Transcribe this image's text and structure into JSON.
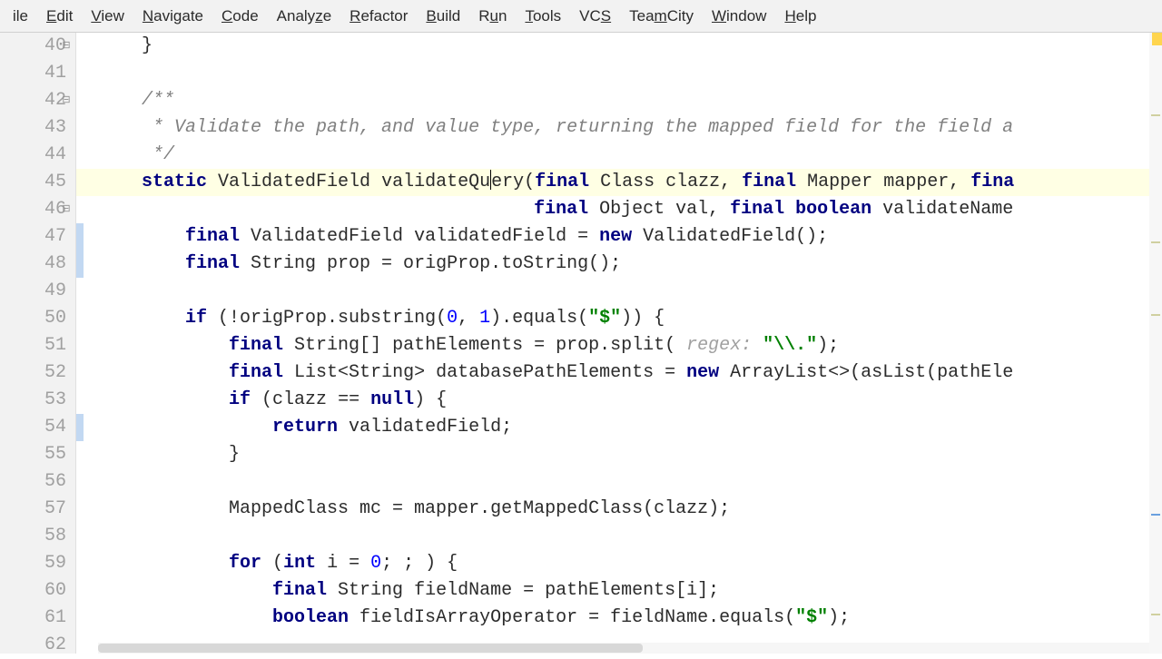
{
  "menu": {
    "file": "ile",
    "edit": "Edit",
    "view": "View",
    "navigate": "Navigate",
    "code": "Code",
    "analyze": "Analyze",
    "refactor": "Refactor",
    "build": "Build",
    "run": "Run",
    "tools": "Tools",
    "vcs": "VCS",
    "teamcity": "TeamCity",
    "window": "Window",
    "help": "Help"
  },
  "gutter": {
    "start": 40,
    "end": 62
  },
  "code": {
    "lines": [
      {
        "n": 40,
        "indent": "    ",
        "tokens": [
          {
            "t": "}",
            "c": ""
          }
        ]
      },
      {
        "n": 41,
        "indent": "",
        "tokens": []
      },
      {
        "n": 42,
        "indent": "    ",
        "tokens": [
          {
            "t": "/**",
            "c": "comment"
          }
        ]
      },
      {
        "n": 43,
        "indent": "     ",
        "tokens": [
          {
            "t": "* Validate the path, and value type, returning the mapped field for the field a",
            "c": "comment"
          }
        ]
      },
      {
        "n": 44,
        "indent": "     ",
        "tokens": [
          {
            "t": "*/",
            "c": "comment"
          }
        ]
      },
      {
        "n": 45,
        "indent": "    ",
        "current": true,
        "tokens": [
          {
            "t": "static",
            "c": "kw"
          },
          {
            "t": " ValidatedField validateQu",
            "c": ""
          },
          {
            "t": "|CARET|",
            "c": ""
          },
          {
            "t": "ery(",
            "c": ""
          },
          {
            "t": "final",
            "c": "kw"
          },
          {
            "t": " Class clazz, ",
            "c": ""
          },
          {
            "t": "final",
            "c": "kw"
          },
          {
            "t": " Mapper mapper, ",
            "c": ""
          },
          {
            "t": "fina",
            "c": "kw"
          }
        ]
      },
      {
        "n": 46,
        "indent": "                                        ",
        "tokens": [
          {
            "t": "final",
            "c": "kw"
          },
          {
            "t": " Object val, ",
            "c": ""
          },
          {
            "t": "final",
            "c": "kw"
          },
          {
            "t": " ",
            "c": ""
          },
          {
            "t": "boolean",
            "c": "kw"
          },
          {
            "t": " validateName",
            "c": ""
          }
        ]
      },
      {
        "n": 47,
        "indent": "        ",
        "tokens": [
          {
            "t": "final",
            "c": "kw"
          },
          {
            "t": " ValidatedField validatedField = ",
            "c": ""
          },
          {
            "t": "new",
            "c": "kw"
          },
          {
            "t": " ValidatedField();",
            "c": ""
          }
        ]
      },
      {
        "n": 48,
        "indent": "        ",
        "tokens": [
          {
            "t": "final",
            "c": "kw"
          },
          {
            "t": " String prop = origProp.toString();",
            "c": ""
          }
        ]
      },
      {
        "n": 49,
        "indent": "",
        "tokens": []
      },
      {
        "n": 50,
        "indent": "        ",
        "tokens": [
          {
            "t": "if",
            "c": "kw"
          },
          {
            "t": " (!origProp.substring(",
            "c": ""
          },
          {
            "t": "0",
            "c": "num"
          },
          {
            "t": ", ",
            "c": ""
          },
          {
            "t": "1",
            "c": "num"
          },
          {
            "t": ").equals(",
            "c": ""
          },
          {
            "t": "\"$\"",
            "c": "str"
          },
          {
            "t": ")) {",
            "c": ""
          }
        ]
      },
      {
        "n": 51,
        "indent": "            ",
        "tokens": [
          {
            "t": "final",
            "c": "kw"
          },
          {
            "t": " String[] pathElements = prop.split( ",
            "c": ""
          },
          {
            "t": "regex: ",
            "c": "hint"
          },
          {
            "t": "\"\\\\.\"",
            "c": "str"
          },
          {
            "t": ");",
            "c": ""
          }
        ]
      },
      {
        "n": 52,
        "indent": "            ",
        "tokens": [
          {
            "t": "final",
            "c": "kw"
          },
          {
            "t": " List<String> databasePathElements = ",
            "c": ""
          },
          {
            "t": "new",
            "c": "kw"
          },
          {
            "t": " ArrayList<>(",
            "c": ""
          },
          {
            "t": "asList",
            "c": ""
          },
          {
            "t": "(pathEle",
            "c": ""
          }
        ]
      },
      {
        "n": 53,
        "indent": "            ",
        "tokens": [
          {
            "t": "if",
            "c": "kw"
          },
          {
            "t": " (clazz == ",
            "c": ""
          },
          {
            "t": "null",
            "c": "kw"
          },
          {
            "t": ") {",
            "c": ""
          }
        ]
      },
      {
        "n": 54,
        "indent": "                ",
        "tokens": [
          {
            "t": "return",
            "c": "kw"
          },
          {
            "t": " validatedField;",
            "c": ""
          }
        ]
      },
      {
        "n": 55,
        "indent": "            ",
        "tokens": [
          {
            "t": "}",
            "c": ""
          }
        ]
      },
      {
        "n": 56,
        "indent": "",
        "tokens": []
      },
      {
        "n": 57,
        "indent": "            ",
        "tokens": [
          {
            "t": "MappedClass mc = mapper.getMappedClass(clazz);",
            "c": ""
          }
        ]
      },
      {
        "n": 58,
        "indent": "",
        "tokens": []
      },
      {
        "n": 59,
        "indent": "            ",
        "tokens": [
          {
            "t": "for",
            "c": "kw"
          },
          {
            "t": " (",
            "c": ""
          },
          {
            "t": "int",
            "c": "kw"
          },
          {
            "t": " i = ",
            "c": ""
          },
          {
            "t": "0",
            "c": "num"
          },
          {
            "t": "; ; ) {",
            "c": ""
          }
        ]
      },
      {
        "n": 60,
        "indent": "                ",
        "tokens": [
          {
            "t": "final",
            "c": "kw"
          },
          {
            "t": " String fieldName = pathElements[i];",
            "c": ""
          }
        ]
      },
      {
        "n": 61,
        "indent": "                ",
        "tokens": [
          {
            "t": "boolean",
            "c": "kw"
          },
          {
            "t": " fieldIsArrayOperator = fieldName.equals(",
            "c": ""
          },
          {
            "t": "\"$\"",
            "c": "str"
          },
          {
            "t": ");",
            "c": ""
          }
        ]
      },
      {
        "n": 62,
        "indent": "",
        "tokens": []
      }
    ]
  }
}
